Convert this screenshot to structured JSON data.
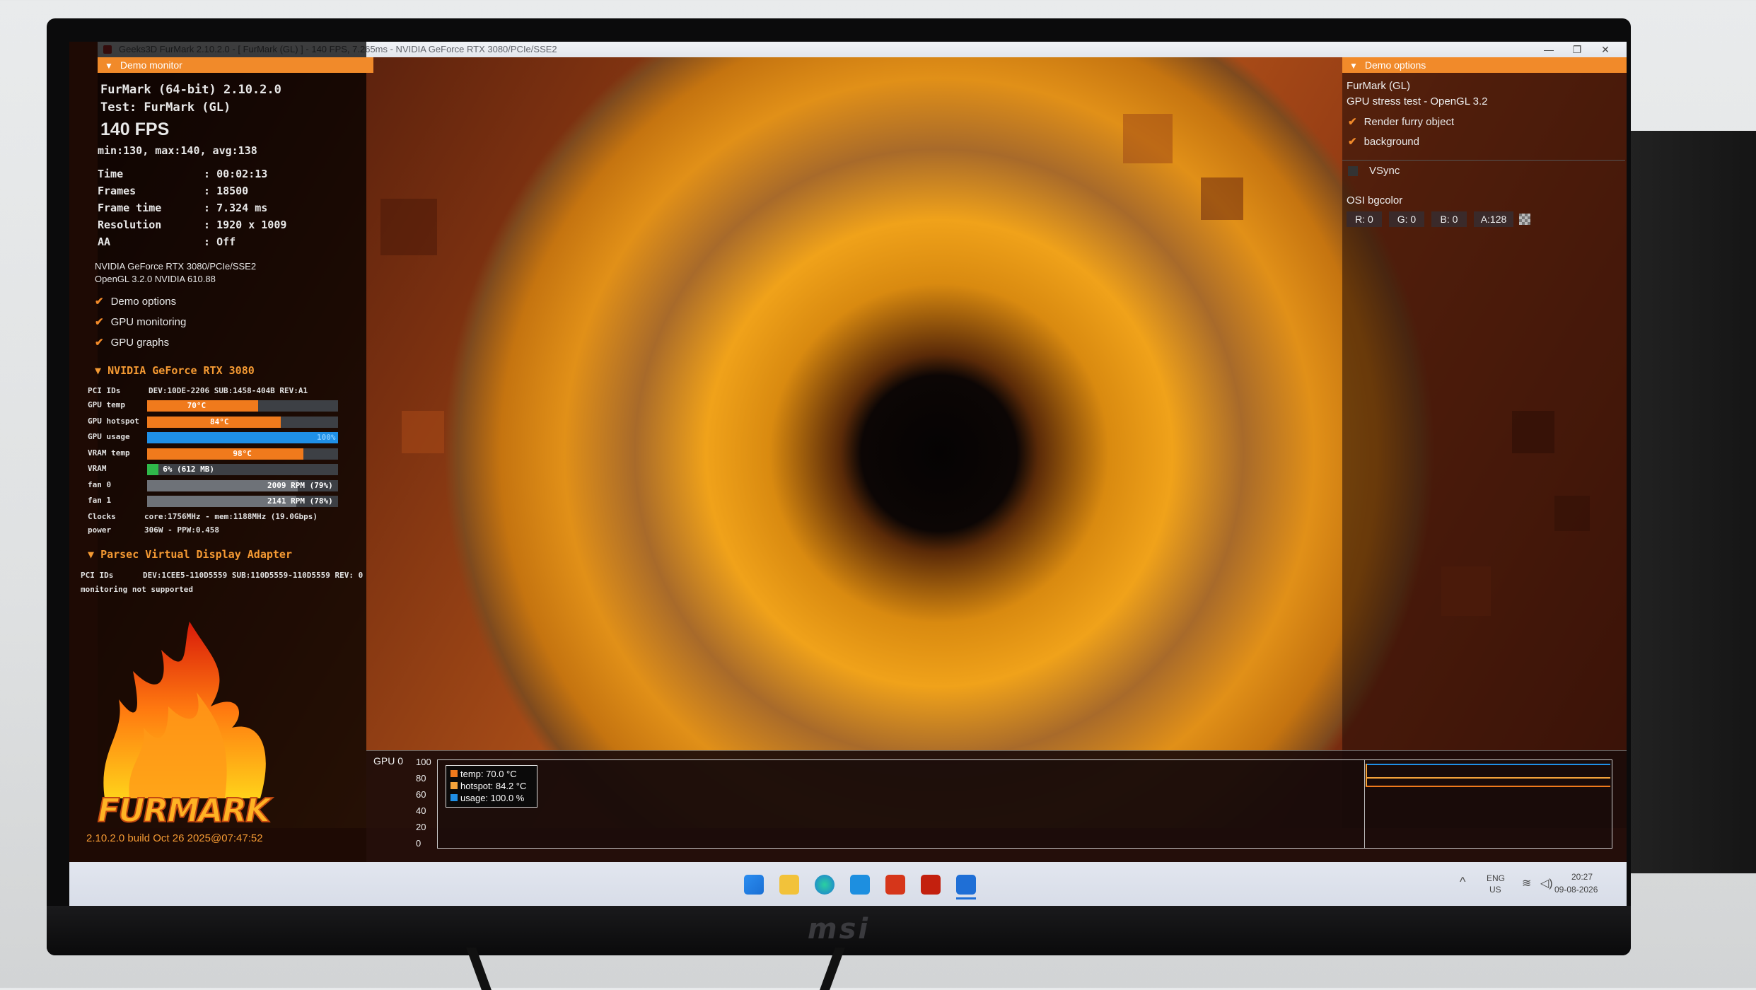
{
  "window": {
    "title": "Geeks3D FurMark 2.10.2.0 - [ FurMark (GL) ] - 140 FPS, 7.265ms - NVIDIA GeForce RTX 3080/PCIe/SSE2"
  },
  "demo_monitor": {
    "header": "Demo monitor",
    "app": "FurMark (64-bit) 2.10.2.0",
    "test": "Test: FurMark (GL)",
    "fps": "140 FPS",
    "fps_stats": "min:130, max:140, avg:138",
    "stats": [
      {
        "label": "Time",
        "value": "00:02:13"
      },
      {
        "label": "Frames",
        "value": "18500"
      },
      {
        "label": "Frame time",
        "value": "7.324 ms"
      },
      {
        "label": "Resolution",
        "value": "1920 x 1009"
      },
      {
        "label": "AA",
        "value": "Off"
      }
    ],
    "renderer": "NVIDIA GeForce RTX 3080/PCIe/SSE2",
    "opengl": "OpenGL 3.2.0 NVIDIA 610.88",
    "toggles": [
      {
        "label": "Demo options",
        "checked": true
      },
      {
        "label": "GPU monitoring",
        "checked": true
      },
      {
        "label": "GPU graphs",
        "checked": true
      }
    ]
  },
  "gpu0": {
    "header": "NVIDIA GeForce RTX 3080",
    "pci_label": "PCI IDs",
    "pci": "DEV:10DE-2206 SUB:1458-404B REV:A1",
    "rows": [
      {
        "label": "GPU temp",
        "text": "70°C",
        "fill": 0.58,
        "color": "#f07a1c"
      },
      {
        "label": "GPU hotspot",
        "text": "84°C",
        "fill": 0.7,
        "color": "#f07a1c"
      },
      {
        "label": "GPU usage",
        "text": "100%",
        "fill": 1.0,
        "color": "#1f8fe6"
      },
      {
        "label": "VRAM temp",
        "text": "98°C",
        "fill": 0.82,
        "color": "#f07a1c"
      },
      {
        "label": "VRAM",
        "text": "6% (612 MB)",
        "fill": 0.06,
        "color": "#2fb84a"
      },
      {
        "label": "fan 0",
        "text": "2009 RPM (79%)",
        "fill": 0.79,
        "color": "#6e7278"
      },
      {
        "label": "fan 1",
        "text": "2141 RPM (78%)",
        "fill": 0.78,
        "color": "#6e7278"
      }
    ],
    "clocks_label": "Clocks",
    "clocks": "core:1756MHz - mem:1188MHz (19.0Gbps)",
    "power_label": "power",
    "power": "306W - PPW:0.458"
  },
  "gpu1": {
    "header": "Parsec Virtual Display Adapter",
    "pci_label": "PCI IDs",
    "pci": "DEV:1CEE5-110D5559 SUB:110D5559-110D5559 REV: 0",
    "note": "monitoring not supported"
  },
  "branding": {
    "logo": "FURMARK",
    "build": "2.10.2.0 build Oct 26 2025@07:47:52"
  },
  "demo_options": {
    "header": "Demo options",
    "title": "FurMark (GL)",
    "subtitle": "GPU stress test - OpenGL 3.2",
    "render_furry": "Render furry object",
    "background": "background",
    "vsync": "VSync",
    "osi_label": "OSI bgcolor",
    "r": "R: 0",
    "g": "G: 0",
    "b": "B: 0",
    "a": "A:128"
  },
  "graph": {
    "label": "GPU 0",
    "yticks": [
      "100",
      "80",
      "60",
      "40",
      "20",
      "0"
    ],
    "legend": [
      {
        "text": "temp: 70.0 °C",
        "color": "#f07a1c"
      },
      {
        "text": "hotspot: 84.2 °C",
        "color": "#f5a33a"
      },
      {
        "text": "usage: 100.0 %",
        "color": "#1f8fe6"
      }
    ]
  },
  "taskbar": {
    "lang": "ENG",
    "region": "US",
    "time": "20:27",
    "date": "09-08-2026"
  },
  "monitor": {
    "brand": "msi"
  }
}
